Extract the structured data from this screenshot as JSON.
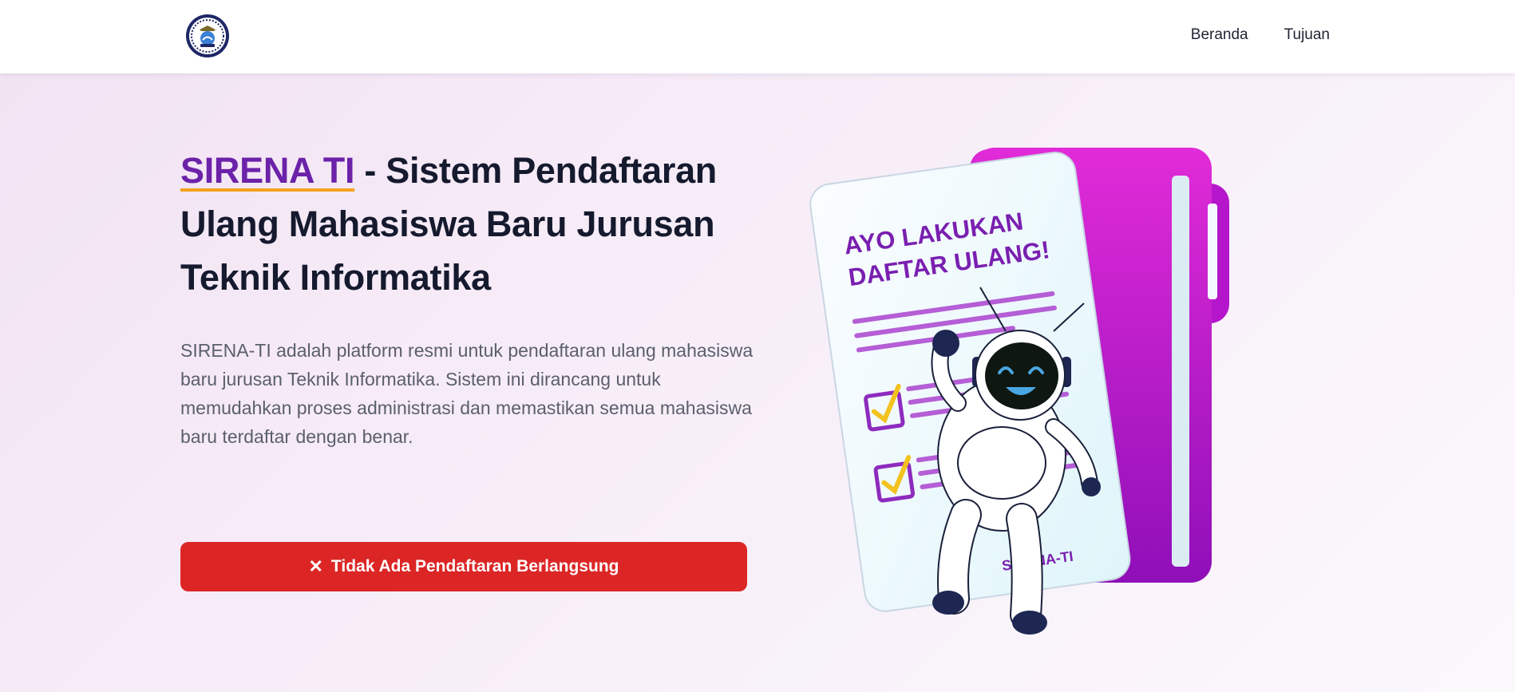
{
  "nav": {
    "logo_icon": "university-seal-icon",
    "links": [
      {
        "label": "Beranda"
      },
      {
        "label": "Tujuan"
      }
    ]
  },
  "hero": {
    "brand": "SIRENA TI",
    "title_rest": " - Sistem Pendaftaran Ulang Mahasiswa Baru Jurusan Teknik Informatika",
    "description": "SIRENA-TI adalah platform resmi untuk pendaftaran ulang mahasiswa baru jurusan Teknik Informatika. Sistem ini dirancang untuk memudahkan proses administrasi dan memastikan semua mahasiswa baru terdaftar dengan benar.",
    "button": {
      "icon": "close-icon",
      "icon_glyph": "✕",
      "label": "Tidak Ada Pendaftaran Berlangsung"
    }
  },
  "illustration": {
    "headline_line1": "AYO LAKUKAN",
    "headline_line2": "DAFTAR ULANG!",
    "footer_label": "SIRENA-TI"
  },
  "colors": {
    "brand_purple": "#6b22a8",
    "underline_orange": "#f3a21f",
    "button_red": "#dc2626",
    "folder_magenta": "#c21bd0"
  }
}
